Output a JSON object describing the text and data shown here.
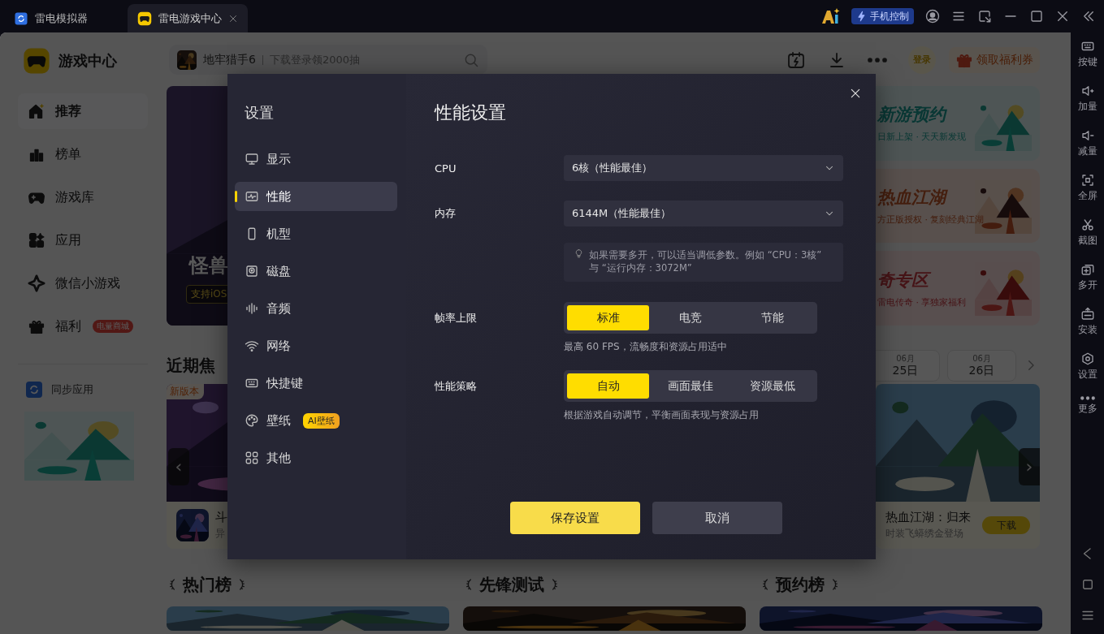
{
  "titlebar": {
    "tabs": [
      {
        "label": "雷电模拟器",
        "selected": false,
        "closable": false
      },
      {
        "label": "雷电游戏中心",
        "selected": true,
        "closable": true
      }
    ],
    "phone_control": "手机控制"
  },
  "toolbar": {
    "items": [
      {
        "label": "按键"
      },
      {
        "label": "加量"
      },
      {
        "label": "减量"
      },
      {
        "label": "全屏"
      },
      {
        "label": "截图"
      },
      {
        "label": "多开"
      },
      {
        "label": "安装"
      },
      {
        "label": "设置"
      },
      {
        "label": "更多"
      }
    ]
  },
  "app": {
    "title": "游戏中心",
    "nav": [
      {
        "label": "推荐",
        "selected": true
      },
      {
        "label": "榜单",
        "selected": false
      },
      {
        "label": "游戏库",
        "selected": false
      },
      {
        "label": "应用",
        "selected": false
      },
      {
        "label": "微信小游戏",
        "selected": false
      },
      {
        "label": "福利",
        "selected": false,
        "badge": "电量商城"
      }
    ],
    "sync": "同步应用"
  },
  "search": {
    "game": "地牢猎手6",
    "promo": "下载登录领2000抽"
  },
  "header": {
    "login": "登录",
    "coupon": "领取福利券"
  },
  "banner": {
    "title": "怪兽",
    "tag": "支持iOS"
  },
  "promo_cards": [
    {
      "title": "新游预约",
      "subtitle": "日新上架 · 天天新发现"
    },
    {
      "title": "热血江湖",
      "subtitle": "方正版授权 · 复刻经典江湖"
    },
    {
      "title": "奇专区",
      "subtitle": "雷电传奇 · 享独家福利"
    }
  ],
  "focus": {
    "heading": "近期焦",
    "dates": [
      {
        "month": "06月",
        "day": "25日"
      },
      {
        "month": "06月",
        "day": "26日"
      }
    ],
    "cards": [
      {
        "tag": "新版本",
        "title": "斗",
        "subtitle": "异",
        "arrow": "‹"
      },
      {
        "title": "热血江湖：归来",
        "subtitle": "时装飞蟒绣金登场",
        "button": "下载",
        "arrow": "›"
      }
    ]
  },
  "rankings": [
    {
      "title": "热门榜"
    },
    {
      "title": "先锋测试"
    },
    {
      "title": "预约榜"
    }
  ],
  "dialog": {
    "title": "设置",
    "menu": [
      {
        "label": "显示",
        "selected": false
      },
      {
        "label": "性能",
        "selected": true
      },
      {
        "label": "机型",
        "selected": false
      },
      {
        "label": "磁盘",
        "selected": false
      },
      {
        "label": "音频",
        "selected": false
      },
      {
        "label": "网络",
        "selected": false
      },
      {
        "label": "快捷键",
        "selected": false
      },
      {
        "label": "壁纸",
        "selected": false,
        "badge": "AI壁纸"
      },
      {
        "label": "其他",
        "selected": false
      }
    ],
    "heading": "性能设置",
    "fields": [
      {
        "kind": "select",
        "label": "CPU",
        "value": "6核（性能最佳）"
      },
      {
        "kind": "select",
        "label": "内存",
        "value": "6144M（性能最佳）"
      },
      {
        "kind": "hint",
        "text": "如果需要多开，可以适当调低参数。例如 “CPU：3核” 与 “运行内存：3072M”"
      },
      {
        "kind": "segmented",
        "label": "帧率上限",
        "options": [
          {
            "label": "标准",
            "selected": true
          },
          {
            "label": "电竞",
            "selected": false
          },
          {
            "label": "节能",
            "selected": false
          }
        ],
        "note": "最高 60 FPS，流畅度和资源占用适中"
      },
      {
        "kind": "segmented",
        "label": "性能策略",
        "options": [
          {
            "label": "自动",
            "selected": true
          },
          {
            "label": "画面最佳",
            "selected": false
          },
          {
            "label": "资源最低",
            "selected": false
          }
        ],
        "note": "根据游戏自动调节，平衡画面表现与资源占用"
      }
    ],
    "buttons": [
      {
        "label": "保存设置",
        "kind": "primary"
      },
      {
        "label": "取消",
        "kind": "secondary"
      }
    ]
  }
}
